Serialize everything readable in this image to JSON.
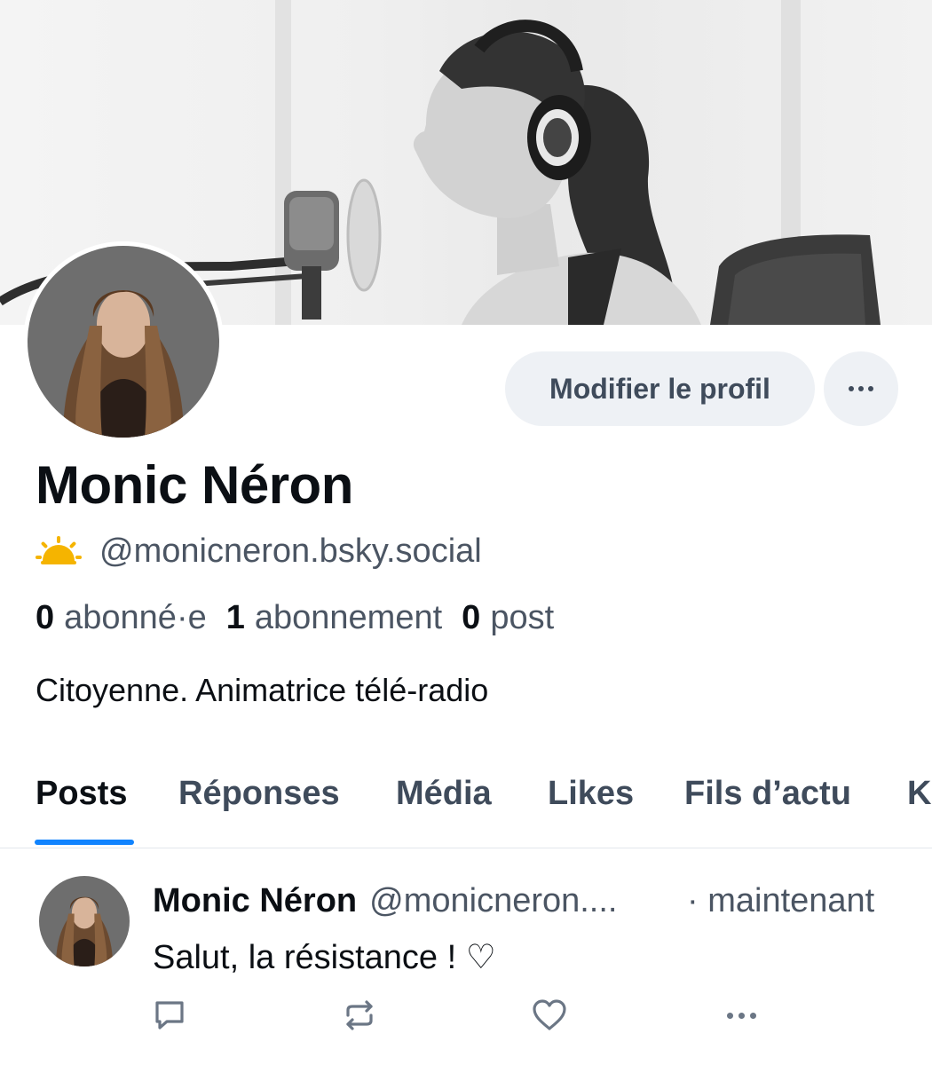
{
  "profile": {
    "display_name": "Monic Néron",
    "handle": "@monicneron.bsky.social",
    "bio": "Citoyenne. Animatrice télé-radio",
    "edit_label": "Modifier le profil",
    "stats": {
      "followers_count": "0",
      "followers_label": "abonné·e",
      "following_count": "1",
      "following_label": "abonnement",
      "posts_count": "0",
      "posts_label": "post"
    }
  },
  "tabs": [
    {
      "label": "Posts",
      "active": true
    },
    {
      "label": "Réponses"
    },
    {
      "label": "Média"
    },
    {
      "label": "Likes"
    },
    {
      "label": "Fils d’actu"
    },
    {
      "label": "K"
    }
  ],
  "post": {
    "author": "Monic Néron",
    "handle": "@monicneron....",
    "time": "· maintenant",
    "text": "Salut, la résistance ! ♡"
  },
  "icons": {
    "handle_emoji": "sun-behind-cloud-icon",
    "more": "ellipsis-icon",
    "reply": "speech-bubble-icon",
    "repost": "repost-icon",
    "like": "heart-icon",
    "post_more": "ellipsis-icon"
  },
  "colors": {
    "accent": "#1083fe",
    "muted_text": "#4b5563",
    "button_bg": "#eef1f5",
    "button_text": "#3f4b5b",
    "sun": "#f5b400"
  }
}
